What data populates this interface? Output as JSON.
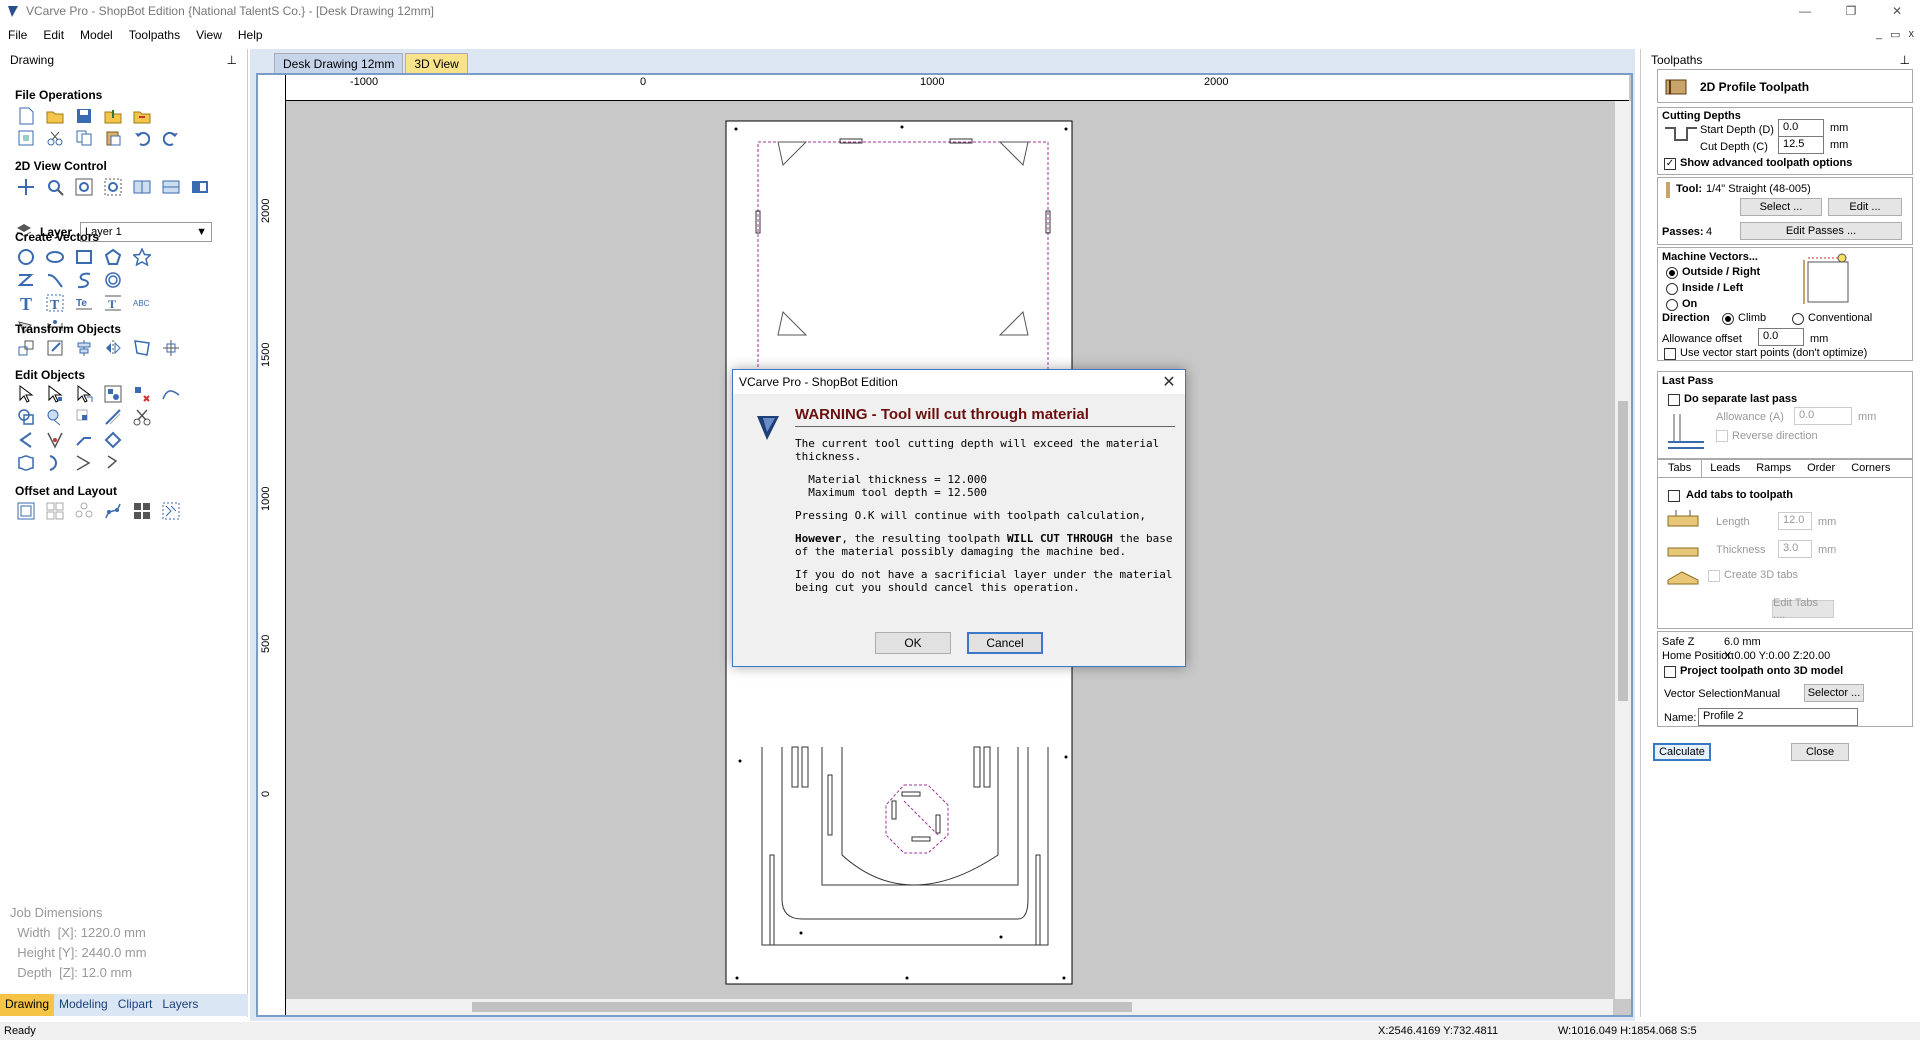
{
  "window": {
    "title": "VCarve Pro - ShopBot Edition {National TalentS Co.} - [Desk Drawing 12mm]",
    "controls": [
      "—",
      "❐",
      "✕"
    ],
    "mdi_controls": [
      "_",
      "▭",
      "x"
    ]
  },
  "menu": [
    "File",
    "Edit",
    "Model",
    "Toolpaths",
    "View",
    "Help"
  ],
  "left_panel": {
    "header": "Drawing",
    "sections": {
      "file_ops": "File Operations",
      "view_ctrl": "2D View Control",
      "create_vectors": "Create Vectors",
      "transform": "Transform Objects",
      "edit": "Edit Objects",
      "offset": "Offset and Layout"
    },
    "layer_label": "Layer",
    "layer_value": "Layer 1",
    "job_dimensions": {
      "title": "Job Dimensions",
      "width": "  Width  [X]: 1220.0 mm",
      "height": "  Height [Y]: 2440.0 mm",
      "depth": "  Depth  [Z]: 12.0 mm"
    },
    "tabs": [
      "Drawing",
      "Modeling",
      "Clipart",
      "Layers"
    ]
  },
  "document": {
    "tabs": [
      "Desk Drawing 12mm",
      "3D View"
    ],
    "hruler_labels": [
      "-1000",
      "0",
      "1000",
      "2000"
    ],
    "vruler_labels": [
      "2000",
      "1500",
      "1000",
      "500",
      "0"
    ]
  },
  "right_panel": {
    "header": "Toolpaths",
    "title": "2D Profile Toolpath",
    "cutting_depths": "Cutting Depths",
    "start_depth_label": "Start Depth (D)",
    "start_depth": "0.0",
    "cut_depth_label": "Cut Depth (C)",
    "cut_depth": "12.5",
    "unit": "mm",
    "show_advanced": "Show advanced toolpath options",
    "tool_label": "Tool:",
    "tool_name": "1/4\" Straight  (48-005)",
    "select_btn": "Select ...",
    "edit_btn": "Edit ...",
    "passes_label": "Passes:",
    "passes_value": "4",
    "edit_passes_btn": "Edit Passes ...",
    "machine_vectors": "Machine Vectors...",
    "mv_outside": "Outside / Right",
    "mv_inside": "Inside / Left",
    "mv_on": "On",
    "direction_label": "Direction",
    "dir_climb": "Climb",
    "dir_conventional": "Conventional",
    "allowance_label": "Allowance offset",
    "allowance_value": "0.0",
    "use_vector_start": "Use vector start points (don't optimize)",
    "last_pass": "Last Pass",
    "do_separate": "Do separate last pass",
    "allowance_a_label": "Allowance (A)",
    "allowance_a_value": "0.0",
    "reverse_direction": "Reverse direction",
    "subtabs": [
      "Tabs",
      "Leads",
      "Ramps",
      "Order",
      "Corners"
    ],
    "add_tabs": "Add tabs to toolpath",
    "length_label": "Length",
    "length_value": "12.0",
    "thickness_label": "Thickness",
    "thickness_value": "3.0",
    "create_3d_tabs": "Create 3D tabs",
    "edit_tabs_btn": "Edit Tabs ....",
    "safe_z_label": "Safe Z",
    "safe_z_value": "6.0 mm",
    "home_label": "Home Position",
    "home_value": "X:0.00 Y:0.00 Z:20.00",
    "project_toolpath": "Project toolpath onto 3D model",
    "vector_selection_label": "Vector Selection:",
    "vector_selection_value": "Manual",
    "selector_btn": "Selector ...",
    "name_label": "Name:",
    "name_value": "Profile 2",
    "calculate_btn": "Calculate",
    "close_btn": "Close"
  },
  "dialog": {
    "title": "VCarve Pro - ShopBot Edition",
    "heading": "WARNING - Tool will cut through material",
    "line1": "The current tool cutting depth will exceed the material thickness.",
    "material_thickness": "  Material thickness = 12.000",
    "max_depth": "  Maximum tool depth = 12.500",
    "line2": "Pressing O.K will continue with toolpath calculation,",
    "line3_bold1": "However",
    "line3_a": ", the resulting toolpath ",
    "line3_bold2": "WILL CUT THROUGH",
    "line3_b": " the base of the material possibly damaging the machine bed.",
    "line4": "If you do not have a sacrificial layer under the material being cut you should cancel this operation.",
    "ok": "OK",
    "cancel": "Cancel"
  },
  "status": {
    "ready": "Ready",
    "coords": "X:2546.4169 Y:732.4811",
    "size": "W:1016.049   H:1854.068  S:5"
  },
  "colors": {
    "accent": "#3c78c8",
    "warning": "#6b0f0f",
    "selection": "#a0309a",
    "active_tab": "#f5c346"
  }
}
